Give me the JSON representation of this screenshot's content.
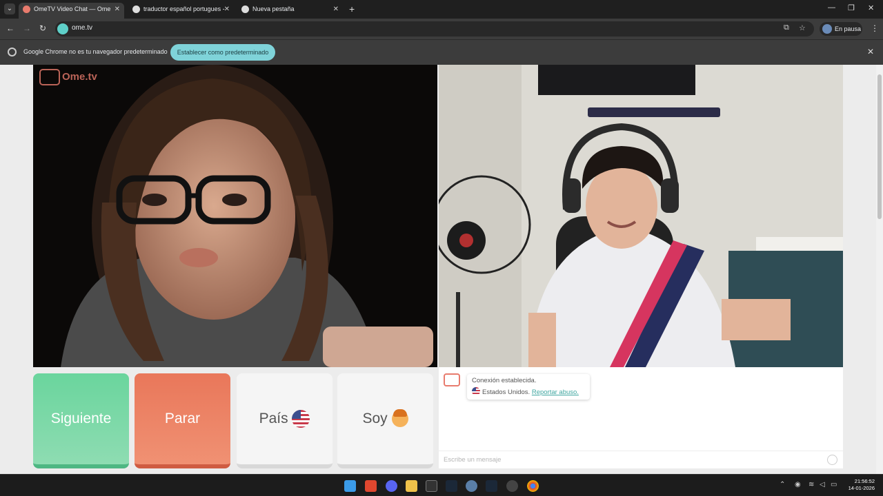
{
  "browser": {
    "tabs": [
      {
        "label": "OmeTV Video Chat — Ome",
        "active": true
      },
      {
        "label": "traductor español portugues -",
        "active": false
      },
      {
        "label": "Nueva pestaña",
        "active": false
      }
    ],
    "url": "ome.tv",
    "profile_label": "En pausa"
  },
  "infobar": {
    "message": "Google Chrome no es tu navegador predeterminado",
    "button_label": "Establecer como predeterminado"
  },
  "site": {
    "logo_text": "Ome.tv"
  },
  "controls": {
    "next_label": "Siguiente",
    "stop_label": "Parar",
    "country_label": "País",
    "me_label": "Soy"
  },
  "chat": {
    "status": "Conexión establecida.",
    "country": "Estados Unidos.",
    "report_link": "Reportar abuso.",
    "input_placeholder": "Escribe un mensaje"
  },
  "taskbar": {
    "time": "21:56:52",
    "date": "14-01-2026"
  },
  "colors": {
    "next_button": "#6ad59d",
    "stop_button": "#e9775a",
    "accent": "#7fd3d9"
  }
}
